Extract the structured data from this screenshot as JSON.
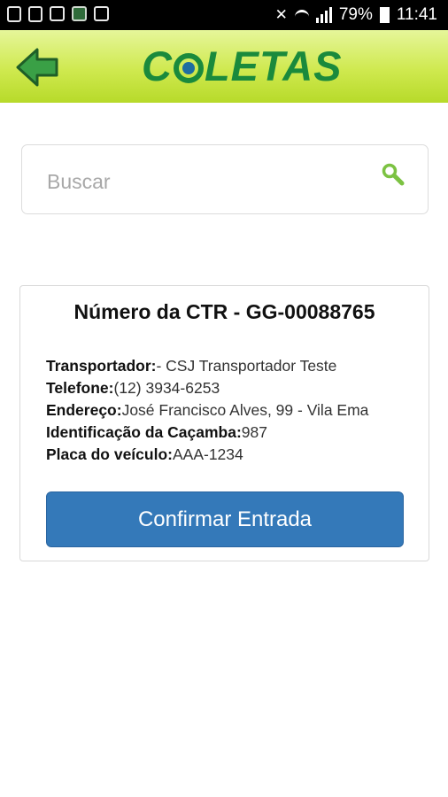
{
  "status_bar": {
    "battery": "79%",
    "time": "11:41"
  },
  "header": {
    "logo_text": "COLETAS",
    "logo_prefix": "C",
    "logo_suffix": "LETAS",
    "back_icon": "arrow-left-icon"
  },
  "search": {
    "placeholder": "Buscar",
    "value": "",
    "icon": "search-icon"
  },
  "card": {
    "title": "Número da CTR - GG-00088765",
    "fields": [
      {
        "label": "Transportador:",
        "value": "- CSJ Transportador Teste"
      },
      {
        "label": "Telefone:",
        "value": "(12) 3934-6253"
      },
      {
        "label": "Endereço:",
        "value": "José Francisco Alves, 99 - Vila Ema"
      },
      {
        "label": "Identificação da Caçamba:",
        "value": "987"
      },
      {
        "label": "Placa do veículo:",
        "value": "AAA-1234"
      }
    ],
    "confirm_label": "Confirmar Entrada"
  },
  "colors": {
    "header_green": "#cfe94f",
    "logo_green": "#1a8a3c",
    "logo_blue": "#1f6ea0",
    "button_blue": "#3479b9",
    "search_icon_green": "#7cc242"
  }
}
